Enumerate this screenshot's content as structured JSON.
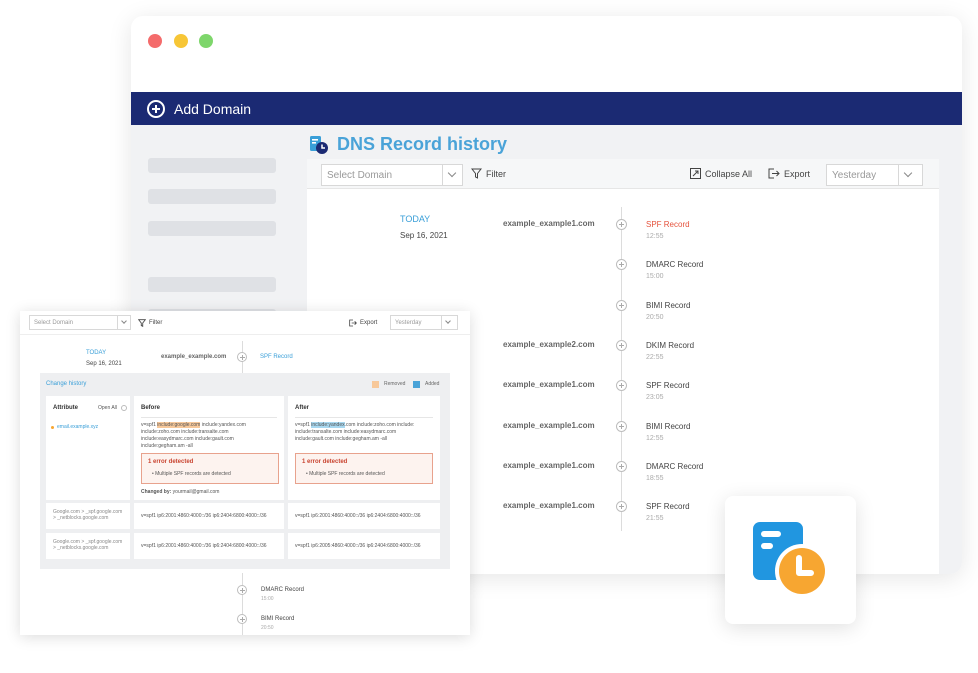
{
  "back": {
    "add_domain": "Add Domain",
    "title": "DNS Record history",
    "select_domain_placeholder": "Select Domain",
    "filter": "Filter",
    "collapse_all": "Collapse All",
    "export": "Export",
    "date_range": "Yesterday",
    "timeline": {
      "today_label": "TODAY",
      "date": "Sep 16, 2021",
      "entries": [
        {
          "domain": "example_example1.com",
          "record": "SPF Record",
          "time": "12:55",
          "highlight": true
        },
        {
          "domain": "",
          "record": "DMARC Record",
          "time": "15:00",
          "highlight": false
        },
        {
          "domain": "",
          "record": "BIMI Record",
          "time": "20:50",
          "highlight": false
        },
        {
          "domain": "example_example2.com",
          "record": "DKIM Record",
          "time": "22:55",
          "highlight": false
        },
        {
          "domain": "example_example1.com",
          "record": "SPF Record",
          "time": "23:05",
          "highlight": false
        },
        {
          "domain": "example_example1.com",
          "record": "BIMI Record",
          "time": "12:55",
          "highlight": false
        },
        {
          "domain": "example_example1.com",
          "record": "DMARC Record",
          "time": "18:55",
          "highlight": false
        },
        {
          "domain": "example_example1.com",
          "record": "SPF Record",
          "time": "21:55",
          "highlight": false
        }
      ]
    }
  },
  "front": {
    "select_domain_placeholder": "Select Domain",
    "filter": "Filter",
    "export": "Export",
    "date_range": "Yesterday",
    "today_label": "TODAY",
    "date": "Sep 16, 2021",
    "domain": "example_example.com",
    "record": "SPF Record",
    "change_history": "Change history",
    "legend_removed": "Removed",
    "legend_added": "Added",
    "attribute_header": "Attribute",
    "open_all": "Open All",
    "attribute_item": "email.example.xyz",
    "before_header": "Before",
    "after_header": "After",
    "before_pre": "v=spf1 ",
    "before_hl": "include:google.com",
    "before_post": " include:yandex.com",
    "before_lines": [
      "include:zoho.com include:transalte.com",
      "include:easydmarc.com include:gault.com",
      "include:gegham.am -all"
    ],
    "after_pre": "v=spf1 ",
    "after_hl": "include:yandex",
    "after_post": ".com include:zoho.com include:",
    "after_lines": [
      "include:transalte.com include:easydmarc.com",
      "include:gault.com include:gegham.am -all"
    ],
    "error_title": "1 error detected",
    "error_item": "Multiple SPF records are detected",
    "changed_by_label": "Changed by:",
    "changed_by_value": "yourmail@gmail.com",
    "rows": [
      {
        "attr1": "Google.com > _spf.google.com",
        "attr2": "> _netblocks.google.com",
        "before": "v=spf1 ip6:2001:4860:4000::/36 ip6:2404:6800:4000::/36",
        "after": "v=spf1 ip6:2001:4860:4000::/36 ip6:2404:6800:4000::/36"
      },
      {
        "attr1": "Google.com > _spf.google.com",
        "attr2": "> _netblocks.google.com",
        "before": "v=spf1 ip6:2001:4860:4000::/36 ip6:2404:6800:4000::/36",
        "after": "v=spf1 ip6:2005:4860:4000::/36 ip6:2404:6800:4000::/36"
      }
    ],
    "below": [
      {
        "record": "DMARC Record",
        "time": "15:00"
      },
      {
        "record": "BIMI Record",
        "time": "20:50"
      }
    ]
  },
  "colors": {
    "navy": "#1b2a73",
    "accent": "#4aa3d8",
    "error": "#e5533d",
    "orange": "#f7a631"
  }
}
